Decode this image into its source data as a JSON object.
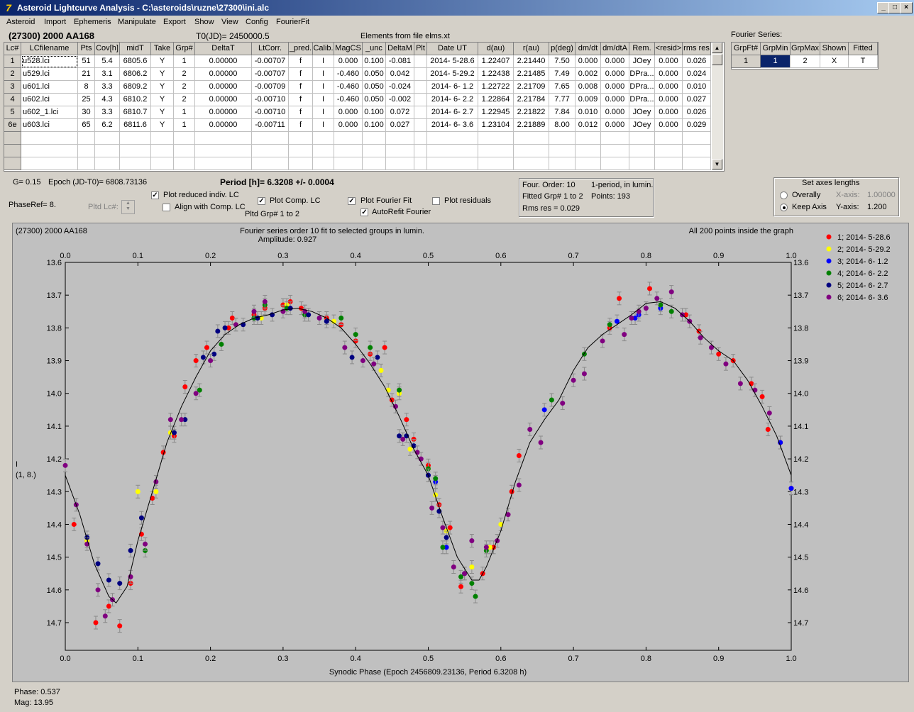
{
  "window": {
    "title": "Asteroid Lightcurve Analysis - C:\\asteroids\\ruzne\\27300\\ini.alc",
    "min": "_",
    "max": "□",
    "close": "×"
  },
  "menu": [
    "Asteroid",
    "Import",
    "Ephemeris",
    "Manipulate",
    "Export",
    "Show",
    "View",
    "Config",
    "FourierFit"
  ],
  "header": {
    "asteroid": "(27300) 2000 AA168",
    "t0": "T0(JD)= 2450000.5",
    "elements": "Elements from file elms.xt"
  },
  "table": {
    "columns": [
      "Lc#",
      "LCfilename",
      "Pts",
      "Cov[h]",
      "midT",
      "Take",
      "Grp#",
      "DeltaT",
      "LtCorr.",
      "_pred.",
      "Calib.",
      "MagCS",
      "_unc",
      "DeltaM",
      "Plt",
      "Date UT",
      "d(au)",
      "r(au)",
      "p(deg)",
      "dm/dt",
      "dm/dtA",
      "Rem.",
      "<resid>",
      "rms res"
    ],
    "rows": [
      [
        "1",
        "u528.lci",
        "51",
        "5.4",
        "6805.6",
        "Y",
        "1",
        "0.00000",
        "-0.00707",
        "f",
        "I",
        "0.000",
        "0.100",
        "-0.081",
        "",
        "2014- 5-28.6",
        "1.22407",
        "2.21440",
        "7.50",
        "0.000",
        "0.000",
        "JOey",
        "0.000",
        "0.026"
      ],
      [
        "2",
        "u529.lci",
        "21",
        "3.1",
        "6806.2",
        "Y",
        "2",
        "0.00000",
        "-0.00707",
        "f",
        "I",
        "-0.460",
        "0.050",
        "0.042",
        "",
        "2014- 5-29.2",
        "1.22438",
        "2.21485",
        "7.49",
        "0.002",
        "0.000",
        "DPra...",
        "0.000",
        "0.024"
      ],
      [
        "3",
        "u601.lci",
        "8",
        "3.3",
        "6809.2",
        "Y",
        "2",
        "0.00000",
        "-0.00709",
        "f",
        "I",
        "-0.460",
        "0.050",
        "-0.024",
        "",
        "2014- 6- 1.2",
        "1.22722",
        "2.21709",
        "7.65",
        "0.008",
        "0.000",
        "DPra...",
        "0.000",
        "0.010"
      ],
      [
        "4",
        "u602.lci",
        "25",
        "4.3",
        "6810.2",
        "Y",
        "2",
        "0.00000",
        "-0.00710",
        "f",
        "I",
        "-0.460",
        "0.050",
        "-0.002",
        "",
        "2014- 6- 2.2",
        "1.22864",
        "2.21784",
        "7.77",
        "0.009",
        "0.000",
        "DPra...",
        "0.000",
        "0.027"
      ],
      [
        "5",
        "u602_1.lci",
        "30",
        "3.3",
        "6810.7",
        "Y",
        "1",
        "0.00000",
        "-0.00710",
        "f",
        "I",
        "0.000",
        "0.100",
        "0.072",
        "",
        "2014- 6- 2.7",
        "1.22945",
        "2.21822",
        "7.84",
        "0.010",
        "0.000",
        "JOey",
        "0.000",
        "0.026"
      ],
      [
        "6e",
        "u603.lci",
        "65",
        "6.2",
        "6811.6",
        "Y",
        "1",
        "0.00000",
        "-0.00711",
        "f",
        "I",
        "0.000",
        "0.100",
        "0.027",
        "",
        "2014- 6- 3.6",
        "1.23104",
        "2.21889",
        "8.00",
        "0.012",
        "0.000",
        "JOey",
        "0.000",
        "0.029"
      ]
    ]
  },
  "fourier": {
    "label": "Fourier Series:",
    "columns": [
      "GrpFt#",
      "GrpMin",
      "GrpMax",
      "Shown",
      "Fitted"
    ],
    "row": [
      "1",
      "1",
      "2",
      "X",
      "T"
    ]
  },
  "controls": {
    "g": "G= 0.15",
    "epoch": "Epoch (JD-T0)= 6808.73136",
    "period": "Period [h]= 6.3208 +/- 0.0004",
    "phaseref": "PhaseRef= 8.",
    "pltd_lc": "Pltd Lc#:",
    "plot_reduced": "Plot reduced indiv. LC",
    "align": "Align with Comp. LC",
    "plot_comp": "Plot Comp. LC",
    "pltd_grp": "Pltd Grp#  1  to   2",
    "plot_fourier": "Plot Fourier Fit",
    "autorefit": "AutoRefit Fourier",
    "plot_resid": "Plot residuals"
  },
  "info": {
    "order": "Four. Order: 10",
    "period_mode": "1-period, in lumin.",
    "fitted": "Fitted Grp# 1 to 2",
    "points": "Points: 193",
    "rms": "Rms res    = 0.029"
  },
  "axes_box": {
    "title": "Set axes lengths",
    "overally": "Overally",
    "keep": "Keep Axis",
    "xaxis_label": "X-axis:",
    "xaxis_value": "1.00000",
    "yaxis_label": "Y-axis:",
    "yaxis_value": "1.200"
  },
  "status": {
    "phase": "Phase:  0.537",
    "mag": "Mag:    13.95"
  },
  "chart_data": {
    "type": "scatter",
    "title": "Fourier series order 10 fit to selected groups in lumin.",
    "subtitle": "Amplitude: 0.927",
    "left_note": "(27300) 2000 AA168",
    "right_note": "All 200 points inside the graph",
    "xlabel": "Synodic Phase (Epoch 2456809.23136, Period 6.3208 h)",
    "ylabel": "I",
    "ylabel2": "(1, 8.)",
    "xlim": [
      0,
      1
    ],
    "ylim": [
      13.6,
      14.8
    ],
    "x_ticks": [
      "0.0",
      "0.1",
      "0.2",
      "0.3",
      "0.4",
      "0.5",
      "0.6",
      "0.7",
      "0.8",
      "0.9",
      "1.0"
    ],
    "y_ticks": [
      "13.6",
      "13.7",
      "13.8",
      "13.9",
      "14.0",
      "14.1",
      "14.2",
      "14.3",
      "14.4",
      "14.5",
      "14.6",
      "14.7"
    ],
    "y_tick_values": [
      13.6,
      13.7,
      13.8,
      13.9,
      14.0,
      14.1,
      14.2,
      14.3,
      14.4,
      14.5,
      14.6,
      14.7
    ],
    "series": [
      {
        "name": "1; 2014- 5-28.6",
        "color": "#ff0000",
        "points": [
          [
            0.012,
            14.4
          ],
          [
            0.03,
            14.45
          ],
          [
            0.042,
            14.7
          ],
          [
            0.06,
            14.65
          ],
          [
            0.075,
            14.71
          ],
          [
            0.09,
            14.58
          ],
          [
            0.105,
            14.43
          ],
          [
            0.12,
            14.32
          ],
          [
            0.135,
            14.18
          ],
          [
            0.15,
            14.13
          ],
          [
            0.165,
            13.98
          ],
          [
            0.18,
            13.9
          ],
          [
            0.195,
            13.86
          ],
          [
            0.225,
            13.8
          ],
          [
            0.23,
            13.77
          ],
          [
            0.26,
            13.76
          ],
          [
            0.275,
            13.74
          ],
          [
            0.3,
            13.73
          ],
          [
            0.31,
            13.72
          ],
          [
            0.325,
            13.74
          ],
          [
            0.36,
            13.77
          ],
          [
            0.38,
            13.79
          ],
          [
            0.4,
            13.84
          ],
          [
            0.42,
            13.88
          ],
          [
            0.44,
            13.86
          ],
          [
            0.45,
            14.02
          ],
          [
            0.47,
            14.08
          ],
          [
            0.48,
            14.14
          ],
          [
            0.5,
            14.22
          ],
          [
            0.515,
            14.34
          ],
          [
            0.53,
            14.41
          ],
          [
            0.545,
            14.59
          ],
          [
            0.575,
            14.55
          ],
          [
            0.59,
            14.47
          ],
          [
            0.615,
            14.3
          ],
          [
            0.625,
            14.19
          ],
          [
            0.75,
            13.8
          ],
          [
            0.763,
            13.71
          ],
          [
            0.805,
            13.68
          ],
          [
            0.855,
            13.76
          ],
          [
            0.873,
            13.81
          ],
          [
            0.9,
            13.88
          ],
          [
            0.92,
            13.9
          ],
          [
            0.945,
            13.97
          ],
          [
            0.96,
            14.01
          ],
          [
            0.968,
            14.11
          ],
          [
            0.985,
            14.15
          ],
          [
            1.0,
            14.29
          ]
        ]
      },
      {
        "name": "2; 2014- 5-29.2",
        "color": "#ffff00",
        "points": [
          [
            0.03,
            14.45
          ],
          [
            0.1,
            14.3
          ],
          [
            0.125,
            14.3
          ],
          [
            0.145,
            14.12
          ],
          [
            0.235,
            13.79
          ],
          [
            0.27,
            13.77
          ],
          [
            0.305,
            13.73
          ],
          [
            0.33,
            13.75
          ],
          [
            0.37,
            13.78
          ],
          [
            0.435,
            13.93
          ],
          [
            0.445,
            13.99
          ],
          [
            0.46,
            14.0
          ],
          [
            0.475,
            14.17
          ],
          [
            0.5,
            14.23
          ],
          [
            0.51,
            14.31
          ],
          [
            0.525,
            14.42
          ],
          [
            0.56,
            14.53
          ],
          [
            0.585,
            14.47
          ],
          [
            0.6,
            14.4
          ]
        ]
      },
      {
        "name": "3; 2014- 6- 1.2",
        "color": "#0000ff",
        "points": [
          [
            0.5,
            14.25
          ],
          [
            0.51,
            14.27
          ],
          [
            0.525,
            14.47
          ],
          [
            0.66,
            14.05
          ],
          [
            0.76,
            13.78
          ],
          [
            0.785,
            13.77
          ],
          [
            0.79,
            13.76
          ],
          [
            0.82,
            13.74
          ],
          [
            0.985,
            14.15
          ],
          [
            1.0,
            14.29
          ]
        ]
      },
      {
        "name": "4; 2014- 6- 2.2",
        "color": "#008000",
        "points": [
          [
            0.11,
            14.48
          ],
          [
            0.185,
            13.99
          ],
          [
            0.215,
            13.85
          ],
          [
            0.26,
            13.77
          ],
          [
            0.275,
            13.73
          ],
          [
            0.305,
            13.74
          ],
          [
            0.33,
            13.76
          ],
          [
            0.38,
            13.77
          ],
          [
            0.4,
            13.82
          ],
          [
            0.42,
            13.86
          ],
          [
            0.46,
            13.99
          ],
          [
            0.5,
            14.23
          ],
          [
            0.51,
            14.26
          ],
          [
            0.52,
            14.47
          ],
          [
            0.545,
            14.56
          ],
          [
            0.56,
            14.58
          ],
          [
            0.565,
            14.62
          ],
          [
            0.58,
            14.48
          ],
          [
            0.67,
            14.02
          ],
          [
            0.715,
            13.88
          ],
          [
            0.75,
            13.79
          ],
          [
            0.82,
            13.73
          ],
          [
            0.835,
            13.75
          ]
        ]
      },
      {
        "name": "5; 2014- 6- 2.7",
        "color": "#000080",
        "points": [
          [
            0.03,
            14.44
          ],
          [
            0.045,
            14.52
          ],
          [
            0.06,
            14.57
          ],
          [
            0.075,
            14.58
          ],
          [
            0.09,
            14.48
          ],
          [
            0.105,
            14.38
          ],
          [
            0.15,
            14.12
          ],
          [
            0.165,
            14.08
          ],
          [
            0.19,
            13.89
          ],
          [
            0.205,
            13.88
          ],
          [
            0.21,
            13.81
          ],
          [
            0.22,
            13.8
          ],
          [
            0.245,
            13.79
          ],
          [
            0.265,
            13.77
          ],
          [
            0.285,
            13.76
          ],
          [
            0.31,
            13.74
          ],
          [
            0.335,
            13.76
          ],
          [
            0.36,
            13.78
          ],
          [
            0.395,
            13.89
          ],
          [
            0.43,
            13.89
          ],
          [
            0.46,
            14.13
          ],
          [
            0.47,
            14.13
          ],
          [
            0.48,
            14.16
          ],
          [
            0.5,
            14.25
          ],
          [
            0.515,
            14.36
          ],
          [
            0.525,
            14.44
          ],
          [
            0.55,
            14.55
          ]
        ]
      },
      {
        "name": "6; 2014- 6- 3.6",
        "color": "#800080",
        "points": [
          [
            0.0,
            14.22
          ],
          [
            0.015,
            14.34
          ],
          [
            0.03,
            14.46
          ],
          [
            0.045,
            14.6
          ],
          [
            0.055,
            14.68
          ],
          [
            0.065,
            14.63
          ],
          [
            0.09,
            14.56
          ],
          [
            0.11,
            14.46
          ],
          [
            0.125,
            14.27
          ],
          [
            0.145,
            14.08
          ],
          [
            0.16,
            14.08
          ],
          [
            0.18,
            14.0
          ],
          [
            0.2,
            13.9
          ],
          [
            0.235,
            13.79
          ],
          [
            0.26,
            13.75
          ],
          [
            0.275,
            13.72
          ],
          [
            0.3,
            13.75
          ],
          [
            0.33,
            13.75
          ],
          [
            0.35,
            13.77
          ],
          [
            0.385,
            13.86
          ],
          [
            0.41,
            13.9
          ],
          [
            0.425,
            13.91
          ],
          [
            0.455,
            14.04
          ],
          [
            0.465,
            14.14
          ],
          [
            0.485,
            14.18
          ],
          [
            0.49,
            14.2
          ],
          [
            0.505,
            14.35
          ],
          [
            0.52,
            14.41
          ],
          [
            0.535,
            14.53
          ],
          [
            0.55,
            14.55
          ],
          [
            0.56,
            14.45
          ],
          [
            0.58,
            14.47
          ],
          [
            0.595,
            14.45
          ],
          [
            0.61,
            14.37
          ],
          [
            0.625,
            14.28
          ],
          [
            0.64,
            14.11
          ],
          [
            0.655,
            14.15
          ],
          [
            0.685,
            14.03
          ],
          [
            0.7,
            13.96
          ],
          [
            0.715,
            13.94
          ],
          [
            0.74,
            13.84
          ],
          [
            0.77,
            13.82
          ],
          [
            0.78,
            13.77
          ],
          [
            0.79,
            13.75
          ],
          [
            0.8,
            13.74
          ],
          [
            0.815,
            13.71
          ],
          [
            0.835,
            13.69
          ],
          [
            0.85,
            13.76
          ],
          [
            0.86,
            13.78
          ],
          [
            0.875,
            13.83
          ],
          [
            0.89,
            13.86
          ],
          [
            0.91,
            13.91
          ],
          [
            0.93,
            13.97
          ],
          [
            0.95,
            13.99
          ],
          [
            0.97,
            14.06
          ]
        ]
      }
    ],
    "fit_curve": [
      [
        0.0,
        14.25
      ],
      [
        0.02,
        14.37
      ],
      [
        0.04,
        14.52
      ],
      [
        0.06,
        14.62
      ],
      [
        0.07,
        14.64
      ],
      [
        0.085,
        14.59
      ],
      [
        0.1,
        14.45
      ],
      [
        0.12,
        14.3
      ],
      [
        0.14,
        14.15
      ],
      [
        0.16,
        14.04
      ],
      [
        0.18,
        13.95
      ],
      [
        0.2,
        13.87
      ],
      [
        0.22,
        13.82
      ],
      [
        0.24,
        13.79
      ],
      [
        0.26,
        13.77
      ],
      [
        0.28,
        13.76
      ],
      [
        0.3,
        13.745
      ],
      [
        0.32,
        13.74
      ],
      [
        0.34,
        13.75
      ],
      [
        0.36,
        13.77
      ],
      [
        0.38,
        13.8
      ],
      [
        0.4,
        13.85
      ],
      [
        0.42,
        13.91
      ],
      [
        0.44,
        13.98
      ],
      [
        0.46,
        14.07
      ],
      [
        0.48,
        14.17
      ],
      [
        0.5,
        14.25
      ],
      [
        0.52,
        14.38
      ],
      [
        0.54,
        14.5
      ],
      [
        0.56,
        14.57
      ],
      [
        0.57,
        14.57
      ],
      [
        0.58,
        14.53
      ],
      [
        0.6,
        14.42
      ],
      [
        0.62,
        14.27
      ],
      [
        0.64,
        14.15
      ],
      [
        0.66,
        14.08
      ],
      [
        0.68,
        14.02
      ],
      [
        0.7,
        13.93
      ],
      [
        0.72,
        13.86
      ],
      [
        0.74,
        13.82
      ],
      [
        0.76,
        13.79
      ],
      [
        0.78,
        13.76
      ],
      [
        0.8,
        13.725
      ],
      [
        0.82,
        13.72
      ],
      [
        0.84,
        13.74
      ],
      [
        0.86,
        13.78
      ],
      [
        0.88,
        13.83
      ],
      [
        0.9,
        13.87
      ],
      [
        0.92,
        13.9
      ],
      [
        0.94,
        13.96
      ],
      [
        0.96,
        14.04
      ],
      [
        0.98,
        14.13
      ],
      [
        1.0,
        14.25
      ]
    ]
  }
}
